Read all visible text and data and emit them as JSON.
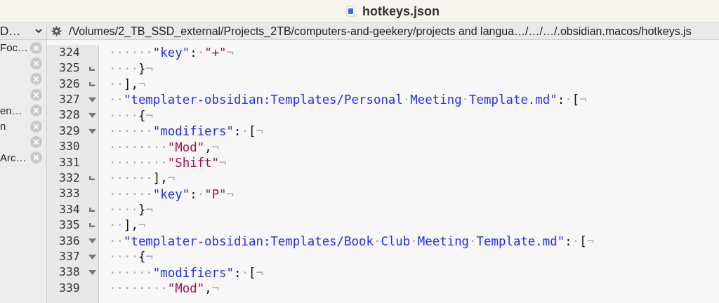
{
  "window": {
    "title": "hotkeys.json"
  },
  "sidebar": {
    "header": "D…",
    "items": [
      {
        "kind": "tab",
        "label": "Foc…"
      },
      {
        "kind": "tab"
      },
      {
        "kind": "tab"
      },
      {
        "kind": "tab"
      },
      {
        "kind": "tab",
        "label": "en…"
      },
      {
        "kind": "tab",
        "label": "n"
      },
      {
        "kind": "tab"
      },
      {
        "kind": "tab",
        "label": "Arc…"
      }
    ]
  },
  "path_bar": {
    "path": "/Volumes/2_TB_SSD_external/Projects_2TB/computers-and-geekery/projects and langua…/…/…/.obsidian.macos/hotkeys.js"
  },
  "editor": {
    "lines": [
      {
        "number": "324",
        "kind": "plain",
        "segments": [
          {
            "kind": "ws",
            "text": "······"
          },
          {
            "kind": "key",
            "text": "\"key\""
          },
          {
            "kind": "punct",
            "text": ":"
          },
          {
            "kind": "ws",
            "text": "·"
          },
          {
            "kind": "str",
            "text": "\"+\""
          },
          {
            "kind": "ws",
            "text": "¬"
          }
        ]
      },
      {
        "number": "325",
        "kind": "fold_end",
        "segments": [
          {
            "kind": "ws",
            "text": "····"
          },
          {
            "kind": "punct",
            "text": "}"
          },
          {
            "kind": "ws",
            "text": "¬"
          }
        ]
      },
      {
        "number": "326",
        "kind": "fold_end",
        "segments": [
          {
            "kind": "ws",
            "text": "··"
          },
          {
            "kind": "punct",
            "text": "],"
          },
          {
            "kind": "ws",
            "text": "¬"
          }
        ]
      },
      {
        "number": "327",
        "kind": "fold_open",
        "segments": [
          {
            "kind": "ws",
            "text": "··"
          },
          {
            "kind": "key",
            "text": "\"templater-obsidian:Templates/Personal"
          },
          {
            "kind": "ws",
            "text": "·"
          },
          {
            "kind": "key",
            "text": "Meeting"
          },
          {
            "kind": "ws",
            "text": "·"
          },
          {
            "kind": "key",
            "text": "Template.md\""
          },
          {
            "kind": "punct",
            "text": ":"
          },
          {
            "kind": "ws",
            "text": "·"
          },
          {
            "kind": "punct",
            "text": "["
          },
          {
            "kind": "ws",
            "text": "¬"
          }
        ]
      },
      {
        "number": "328",
        "kind": "fold_open",
        "segments": [
          {
            "kind": "ws",
            "text": "····"
          },
          {
            "kind": "punct",
            "text": "{"
          },
          {
            "kind": "ws",
            "text": "¬"
          }
        ]
      },
      {
        "number": "329",
        "kind": "fold_open",
        "segments": [
          {
            "kind": "ws",
            "text": "······"
          },
          {
            "kind": "key",
            "text": "\"modifiers\""
          },
          {
            "kind": "punct",
            "text": ":"
          },
          {
            "kind": "ws",
            "text": "·"
          },
          {
            "kind": "punct",
            "text": "["
          },
          {
            "kind": "ws",
            "text": "¬"
          }
        ]
      },
      {
        "number": "330",
        "kind": "plain",
        "segments": [
          {
            "kind": "ws",
            "text": "········"
          },
          {
            "kind": "str",
            "text": "\"Mod\""
          },
          {
            "kind": "punct",
            "text": ","
          },
          {
            "kind": "ws",
            "text": "¬"
          }
        ]
      },
      {
        "number": "331",
        "kind": "plain",
        "segments": [
          {
            "kind": "ws",
            "text": "········"
          },
          {
            "kind": "str",
            "text": "\"Shift\""
          },
          {
            "kind": "ws",
            "text": "¬"
          }
        ]
      },
      {
        "number": "332",
        "kind": "fold_end",
        "segments": [
          {
            "kind": "ws",
            "text": "······"
          },
          {
            "kind": "punct",
            "text": "],"
          },
          {
            "kind": "ws",
            "text": "¬"
          }
        ]
      },
      {
        "number": "333",
        "kind": "plain",
        "segments": [
          {
            "kind": "ws",
            "text": "······"
          },
          {
            "kind": "key",
            "text": "\"key\""
          },
          {
            "kind": "punct",
            "text": ":"
          },
          {
            "kind": "ws",
            "text": "·"
          },
          {
            "kind": "str",
            "text": "\"P\""
          },
          {
            "kind": "ws",
            "text": "¬"
          }
        ]
      },
      {
        "number": "334",
        "kind": "fold_end",
        "segments": [
          {
            "kind": "ws",
            "text": "····"
          },
          {
            "kind": "punct",
            "text": "}"
          },
          {
            "kind": "ws",
            "text": "¬"
          }
        ]
      },
      {
        "number": "335",
        "kind": "fold_end",
        "segments": [
          {
            "kind": "ws",
            "text": "··"
          },
          {
            "kind": "punct",
            "text": "],"
          },
          {
            "kind": "ws",
            "text": "¬"
          }
        ]
      },
      {
        "number": "336",
        "kind": "fold_open",
        "segments": [
          {
            "kind": "ws",
            "text": "··"
          },
          {
            "kind": "key",
            "text": "\"templater-obsidian:Templates/Book"
          },
          {
            "kind": "ws",
            "text": "·"
          },
          {
            "kind": "key",
            "text": "Club"
          },
          {
            "kind": "ws",
            "text": "·"
          },
          {
            "kind": "key",
            "text": "Meeting"
          },
          {
            "kind": "ws",
            "text": "·"
          },
          {
            "kind": "key",
            "text": "Template.md\""
          },
          {
            "kind": "punct",
            "text": ":"
          },
          {
            "kind": "ws",
            "text": "·"
          },
          {
            "kind": "punct",
            "text": "["
          },
          {
            "kind": "ws",
            "text": "¬"
          }
        ]
      },
      {
        "number": "337",
        "kind": "fold_open",
        "segments": [
          {
            "kind": "ws",
            "text": "····"
          },
          {
            "kind": "punct",
            "text": "{"
          },
          {
            "kind": "ws",
            "text": "¬"
          }
        ]
      },
      {
        "number": "338",
        "kind": "fold_open",
        "segments": [
          {
            "kind": "ws",
            "text": "······"
          },
          {
            "kind": "key",
            "text": "\"modifiers\""
          },
          {
            "kind": "punct",
            "text": ":"
          },
          {
            "kind": "ws",
            "text": "·"
          },
          {
            "kind": "punct",
            "text": "["
          },
          {
            "kind": "ws",
            "text": "¬"
          }
        ]
      },
      {
        "number": "339",
        "kind": "plain",
        "segments": [
          {
            "kind": "ws",
            "text": "········"
          },
          {
            "kind": "str",
            "text": "\"Mod\""
          },
          {
            "kind": "punct",
            "text": ","
          },
          {
            "kind": "ws",
            "text": "¬"
          }
        ]
      }
    ]
  }
}
